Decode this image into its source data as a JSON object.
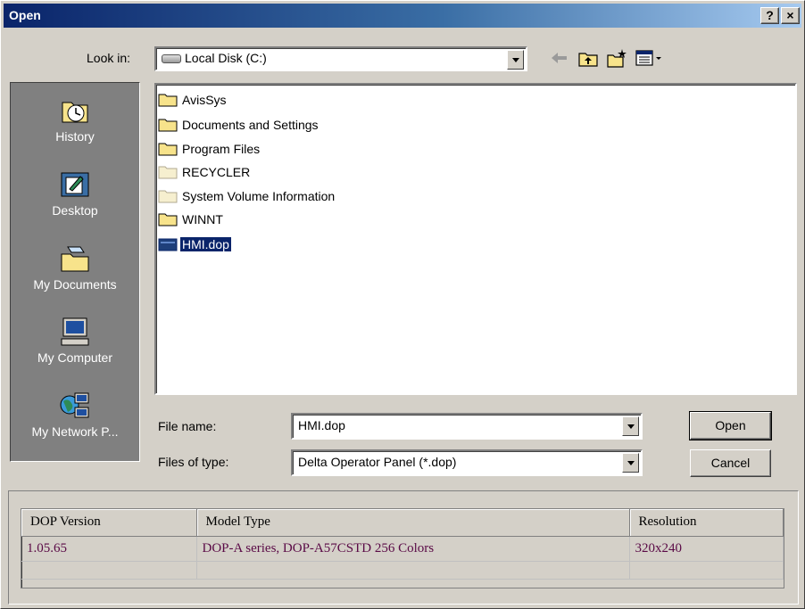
{
  "window": {
    "title": "Open",
    "help_label": "?",
    "close_label": "×"
  },
  "lookin": {
    "label": "Look in:",
    "value": "Local Disk (C:)"
  },
  "places": [
    {
      "label": "History",
      "icon": "history-icon"
    },
    {
      "label": "Desktop",
      "icon": "desktop-icon"
    },
    {
      "label": "My Documents",
      "icon": "my-documents-icon"
    },
    {
      "label": "My Computer",
      "icon": "my-computer-icon"
    },
    {
      "label": "My Network P...",
      "icon": "my-network-places-icon"
    }
  ],
  "files": [
    {
      "name": "AvisSys",
      "type": "folder"
    },
    {
      "name": "Documents and Settings",
      "type": "folder"
    },
    {
      "name": "Program Files",
      "type": "folder"
    },
    {
      "name": "RECYCLER",
      "type": "folder-hidden"
    },
    {
      "name": "System Volume Information",
      "type": "folder-hidden"
    },
    {
      "name": "WINNT",
      "type": "folder"
    },
    {
      "name": "HMI.dop",
      "type": "file",
      "selected": true
    }
  ],
  "filename": {
    "label": "File name:",
    "value": "HMI.dop"
  },
  "filetype": {
    "label": "Files of type:",
    "value": "Delta Operator Panel (*.dop)"
  },
  "buttons": {
    "open": "Open",
    "cancel": "Cancel"
  },
  "info_table": {
    "headers": [
      "DOP Version",
      "Model Type",
      "Resolution"
    ],
    "rows": [
      [
        "1.05.65",
        "DOP-A series,  DOP-A57CSTD 256 Colors",
        "320x240"
      ]
    ]
  },
  "colors": {
    "dialog_face": "#d4d0c8",
    "title_start": "#0a246a",
    "title_end": "#a6caf0",
    "selection": "#0a246a",
    "table_text": "#5a0a46"
  }
}
